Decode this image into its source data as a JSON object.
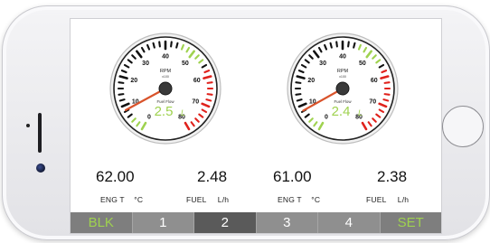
{
  "gauges": [
    {
      "dial_label": "RPM",
      "dial_sub": "x100",
      "flow_label": "Fuel Flow",
      "flow_value": "2.5",
      "flow_unit": "L",
      "ticks": [
        "0",
        "10",
        "20",
        "30",
        "40",
        "50",
        "60",
        "70",
        "80"
      ],
      "needle_value": 8.4
    },
    {
      "dial_label": "RPM",
      "dial_sub": "x100",
      "flow_label": "Fuel Flow",
      "flow_value": "2.4",
      "flow_unit": "L",
      "ticks": [
        "0",
        "10",
        "20",
        "30",
        "40",
        "50",
        "60",
        "70",
        "80"
      ],
      "needle_value": 8.2
    }
  ],
  "readouts": [
    {
      "value": "62.00",
      "label": "ENG T",
      "unit": "°C"
    },
    {
      "value": "2.48",
      "label": "FUEL",
      "unit": "L/h"
    },
    {
      "value": "61.00",
      "label": "ENG T",
      "unit": "°C"
    },
    {
      "value": "2.38",
      "label": "FUEL",
      "unit": "L/h"
    }
  ],
  "nav": [
    "BLK",
    "1",
    "2",
    "3",
    "4",
    "SET"
  ],
  "nav_active": "2",
  "colors": {
    "accent_green": "#9fd24f",
    "danger_red": "#e0221c",
    "needle": "#d9532b",
    "tick_dark": "#111111"
  }
}
